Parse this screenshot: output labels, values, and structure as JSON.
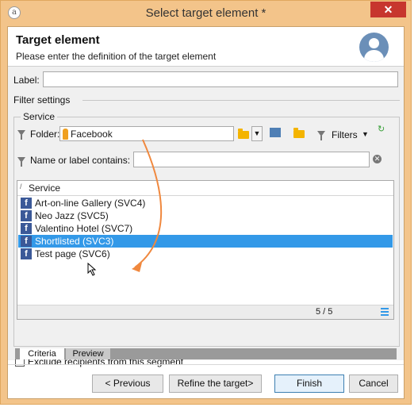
{
  "window": {
    "title": "Select target element *",
    "close_glyph": "✕",
    "app_icon_glyph": "a",
    "accent": "#f3c48a",
    "close_color": "#c7362e"
  },
  "header": {
    "title": "Target element",
    "subtitle": "Please enter the definition of the target element",
    "avatar_icon": "user-icon"
  },
  "form": {
    "label_caption": "Label:",
    "label_value": "",
    "filter_settings": "Filter settings",
    "service_group": "Service",
    "folder_caption": "Folder:",
    "folder_value": "Facebook",
    "filters_label": "Filters",
    "name_filter_caption": "Name or label contains:",
    "name_filter_value": ""
  },
  "list": {
    "column_header": "Service",
    "sort_glyph": "/",
    "items": [
      {
        "label": "Art-on-line Gallery (SVC4)",
        "selected": false
      },
      {
        "label": "Neo Jazz (SVC5)",
        "selected": false
      },
      {
        "label": "Valentino Hotel (SVC7)",
        "selected": false
      },
      {
        "label": "Shortlisted (SVC3)",
        "selected": true
      },
      {
        "label": "Test page (SVC6)",
        "selected": false
      }
    ],
    "count": "5 / 5",
    "selection_color": "#3399e8"
  },
  "exclude": {
    "label": "Exclude recipients from this segment",
    "checked": false
  },
  "tabs": [
    {
      "label": "Criteria",
      "active": true
    },
    {
      "label": "Preview",
      "active": false
    }
  ],
  "buttons": {
    "previous": "< Previous",
    "refine": "Refine the target>",
    "finish": "Finish",
    "cancel": "Cancel"
  }
}
